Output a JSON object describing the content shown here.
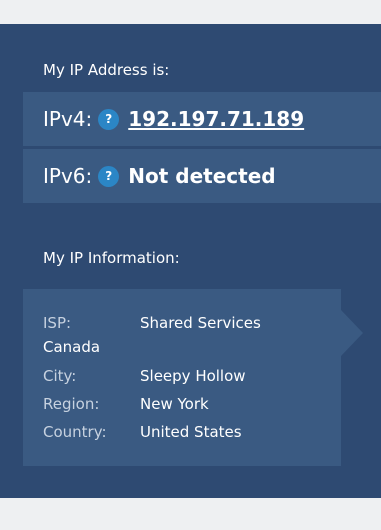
{
  "address_section": {
    "label": "My IP Address is:",
    "ipv4": {
      "label": "IPv4:",
      "help_icon": "?",
      "value": "192.197.71.189"
    },
    "ipv6": {
      "label": "IPv6:",
      "help_icon": "?",
      "value": "Not detected"
    }
  },
  "info_section": {
    "label": "My IP Information:",
    "isp": {
      "key": "ISP:",
      "value_line1": "Shared Services",
      "value_line2": "Canada"
    },
    "city": {
      "key": "City:",
      "value": "Sleepy Hollow"
    },
    "region": {
      "key": "Region:",
      "value": "New York"
    },
    "country": {
      "key": "Country:",
      "value": "United States"
    }
  },
  "colors": {
    "card_bg": "#2e4a72",
    "row_bg": "#3a5a82",
    "help_icon_bg": "#2b86c6",
    "page_bg": "#eef0f2"
  },
  "icons": {
    "help": "question-mark-circle-icon"
  }
}
